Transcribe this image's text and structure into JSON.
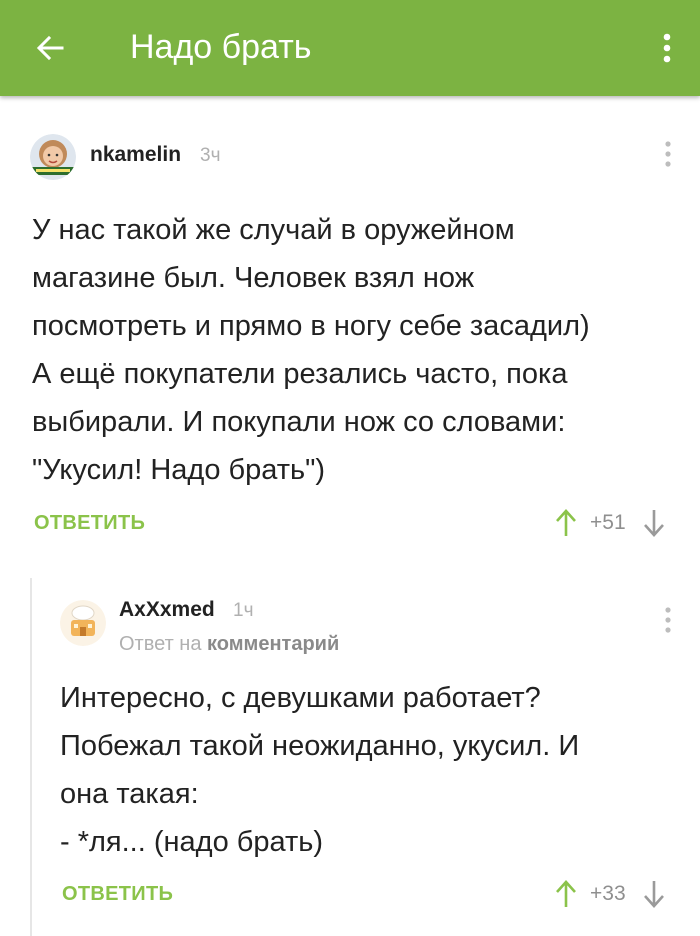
{
  "header": {
    "title": "Надо брать",
    "back_icon": "arrow-left-icon",
    "menu_icon": "more-vertical-icon",
    "color": "#7cb342"
  },
  "comments": [
    {
      "username": "nkamelin",
      "time": "3ч",
      "avatar_icon": "user-avatar-icon",
      "text": "У нас такой же случай в оружейном\nмагазине был. Человек взял нож\nпосмотреть и прямо в ногу себе засадил)\nА ещё покупатели резались часто, пока\nвыбирали. И покупали нож со словами:\n\"Укусил! Надо брать\")",
      "reply_label": "ОТВЕТИТЬ",
      "score": "+51"
    },
    {
      "username": "AxXxmed",
      "time": "1ч",
      "avatar_icon": "house-avatar-icon",
      "reply_to_prefix": "Ответ на",
      "reply_to_target": "комментарий",
      "text": "Интересно, с девушками работает?\nПобежал такой неожиданно, укусил. И\nона такая:\n- *ля... (надо брать)",
      "reply_label": "ОТВЕТИТЬ",
      "score": "+33"
    }
  ],
  "colors": {
    "accent": "#8bc34a",
    "muted": "#b0b0b0"
  }
}
